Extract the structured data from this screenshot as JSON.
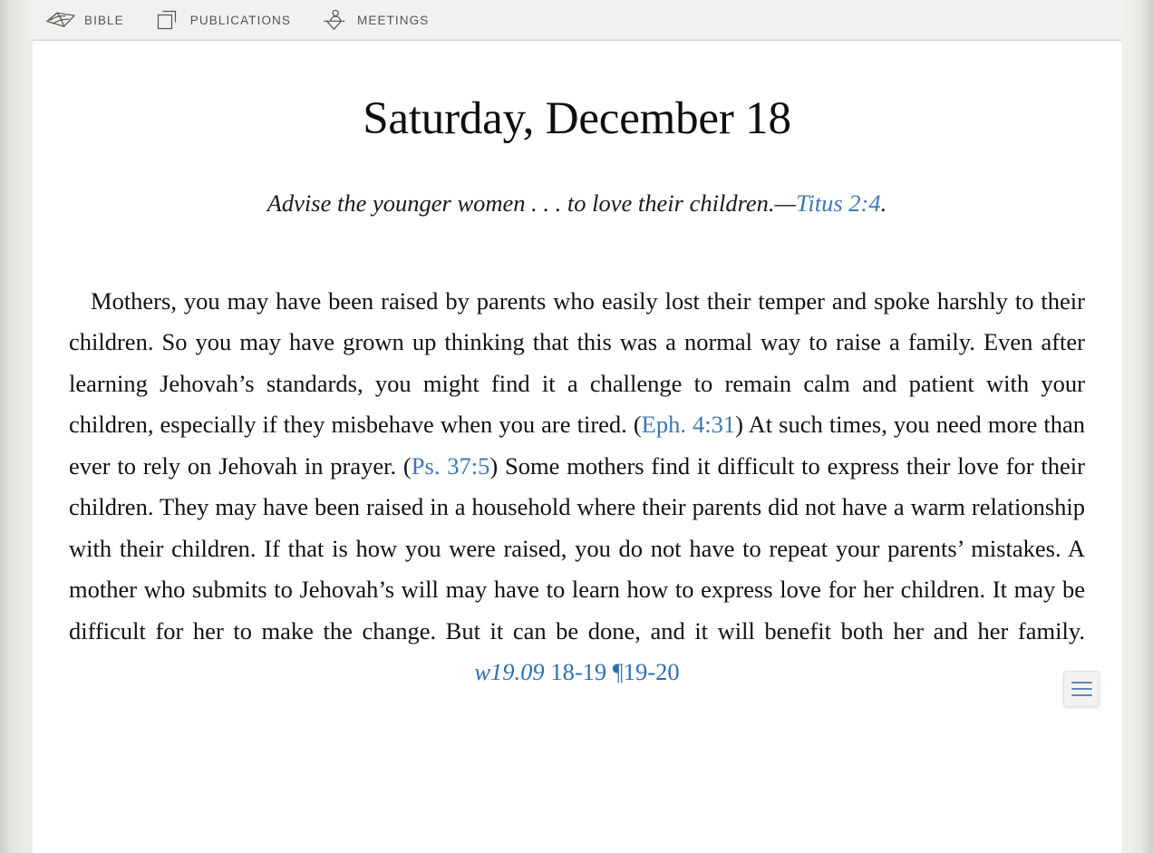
{
  "nav": {
    "items": [
      {
        "label": "BIBLE",
        "icon": "open-book-icon",
        "name": "bible"
      },
      {
        "label": "PUBLICATIONS",
        "icon": "stacked-squares-icon",
        "name": "publications"
      },
      {
        "label": "MEETINGS",
        "icon": "speaker-at-podium-icon",
        "name": "meetings"
      }
    ]
  },
  "article": {
    "day_title": "Saturday, December 18",
    "theme_scripture": {
      "text_before": "Advise the younger women . . . to love their children.—",
      "citation": "Titus 2:4",
      "text_after": "."
    },
    "paragraph": {
      "part1": "Mothers, you may have been raised by parents who easily lost their temper and spoke harshly to their children. So you may have grown up thinking that this was a normal way to raise a family. Even after learning Jehovah’s standards, you might find it a challenge to remain calm and patient with your children, especially if they misbehave when you are tired. (",
      "citation1": "Eph. 4:31",
      "part2": ") At such times, you need more than ever to rely on Jehovah in prayer. (",
      "citation2": "Ps. 37:5",
      "part3": ") Some mothers find it difficult to express their love for their children. They may have been raised in a household where their parents did not have a warm relationship with their children. If that is how you were raised, you do not have to repeat your parents’ mistakes. A mother who submits to Jehovah’s will may have to learn how to express love for her children. It may be difficult for her to make the change. But it can be done, and it will benefit both her and her family. ",
      "publication_symbol": "w19.09",
      "publication_pages": " 18-19 ¶19-20"
    }
  },
  "side_button": {
    "icon": "outline-lines-icon",
    "bar_color": "#5f86bc"
  },
  "colors": {
    "link_blue": "#3c77b5",
    "nav_text": "#56534f",
    "page_background": "#ffffff",
    "gutter": "#e0ddd9"
  }
}
